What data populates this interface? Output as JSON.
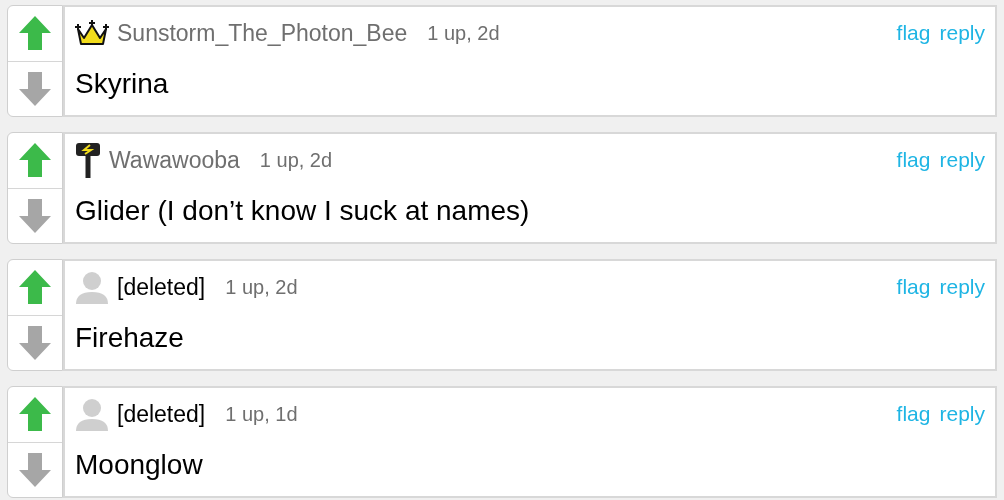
{
  "comments": [
    {
      "kind": "crown",
      "username": "Sunstorm_The_Photon_Bee",
      "deleted": false,
      "meta": "1 up, 2d",
      "text": "Skyrina",
      "upvoted": true,
      "downvoted": false,
      "actions": [
        "flag",
        "reply"
      ]
    },
    {
      "kind": "hammer",
      "username": "Wawawooba",
      "deleted": false,
      "meta": "1 up, 2d",
      "text": "Glider (I don’t know I suck at names)",
      "upvoted": true,
      "downvoted": false,
      "actions": [
        "flag",
        "reply"
      ]
    },
    {
      "kind": "default",
      "username": "[deleted]",
      "deleted": true,
      "meta": "1 up, 2d",
      "text": "Firehaze",
      "upvoted": true,
      "downvoted": false,
      "actions": [
        "flag",
        "reply"
      ]
    },
    {
      "kind": "default",
      "username": "[deleted]",
      "deleted": true,
      "meta": "1 up, 1d",
      "text": "Moonglow",
      "upvoted": true,
      "downvoted": false,
      "actions": [
        "flag",
        "reply"
      ]
    }
  ]
}
